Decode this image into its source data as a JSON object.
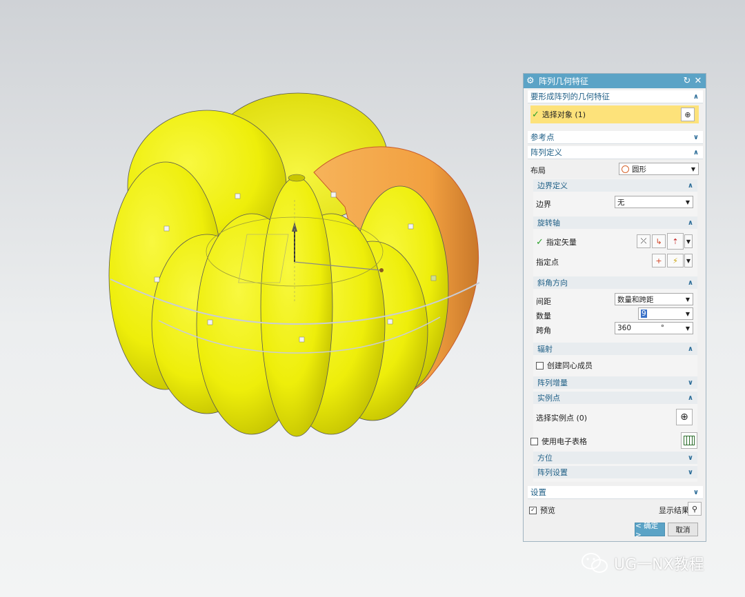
{
  "dialog": {
    "title": "阵列几何特征",
    "reset_icon": "reset-icon",
    "close_icon": "close-icon",
    "sections": {
      "geometry": "要形成阵列的几何特征",
      "select_object": "选择对象 (1)",
      "reference_point": "参考点",
      "pattern_definition": "阵列定义",
      "layout_label": "布局",
      "layout_value": "圆形",
      "boundary_def": "边界定义",
      "boundary_label": "边界",
      "boundary_value": "无",
      "rotation_axis": "旋转轴",
      "specify_vector": "指定矢量",
      "specify_point": "指定点",
      "angular_direction": "斜角方向",
      "spacing_label": "间距",
      "spacing_value": "数量和跨距",
      "count_label": "数量",
      "count_value": "9",
      "span_label": "跨角",
      "span_value": "360",
      "span_unit": "°",
      "radiate": "辐射",
      "create_concentric": "创建同心成员",
      "pattern_increment": "阵列增量",
      "instance_points": "实例点",
      "select_instance_points": "选择实例点 (0)",
      "use_spreadsheet": "使用电子表格",
      "orientation": "方位",
      "pattern_settings": "阵列设置",
      "settings": "设置",
      "preview": "预览",
      "show_result": "显示结果",
      "ok": "< 确定 >",
      "cancel": "取消"
    }
  },
  "watermark": "UG一NX教程",
  "colors": {
    "titlebar": "#5ba3c6",
    "selection": "#fde27a",
    "body_yellow": "#f2f20a",
    "instance_orange": "#f3a24a"
  }
}
